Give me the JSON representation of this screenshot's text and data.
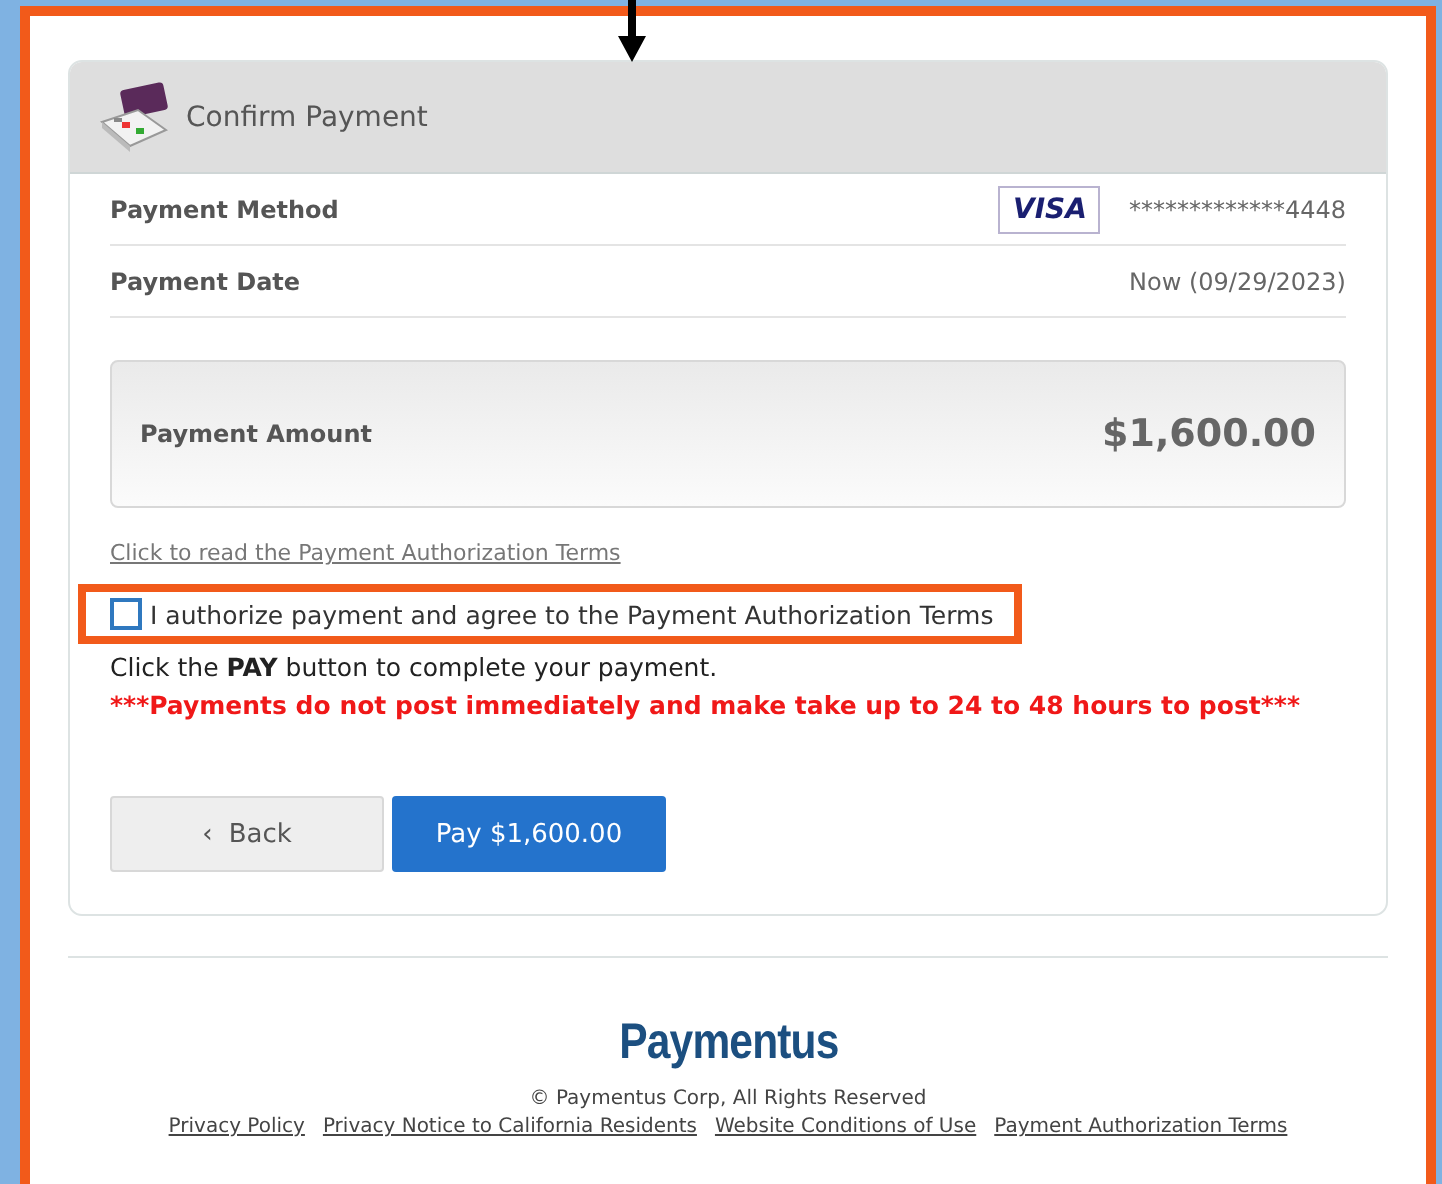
{
  "header": {
    "title": "Confirm Payment"
  },
  "details": [
    {
      "kind": "card",
      "label": "Payment Method",
      "brand": "VISA",
      "value": "*************4448"
    },
    {
      "kind": "text",
      "label": "Payment Date",
      "value": "Now (09/29/2023)"
    }
  ],
  "amount": {
    "label": "Payment Amount",
    "value": "$1,600.00"
  },
  "terms_link": "Click to read the Payment Authorization Terms",
  "authorization": {
    "label": "I authorize payment and agree to the Payment Authorization Terms",
    "checked": false,
    "highlighted": true
  },
  "instruction": "Click the **PAY** button to complete your payment.",
  "warning": "***Payments do not post immediately and make take up to 24 to 48 hours to post***",
  "buttons": {
    "back": {
      "icon": "‹",
      "label": "Back"
    },
    "pay": "Pay $1,600.00"
  },
  "footer": {
    "logo": "Paymentus",
    "copyright": "© Paymentus Corp, All Rights Reserved",
    "links": [
      "Privacy Policy",
      "Privacy Notice to California Residents",
      "Website Conditions of Use",
      "Payment Authorization Terms"
    ]
  }
}
